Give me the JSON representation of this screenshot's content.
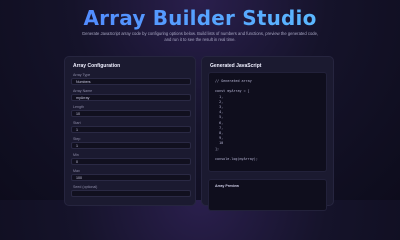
{
  "header": {
    "title": "Array Builder Studio",
    "subtitle": "Generate JavaScript array code by configuring options below. Build lists of numbers and functions, preview the generated code, and run it to see the result in real time."
  },
  "config_panel": {
    "title": "Array Configuration",
    "fields": [
      {
        "label": "Array Type",
        "value": "Numbers"
      },
      {
        "label": "Array Name",
        "value": "myArray"
      },
      {
        "label": "Length",
        "value": "10"
      },
      {
        "label": "Start",
        "value": "1"
      },
      {
        "label": "Step",
        "value": "1"
      },
      {
        "label": "Min",
        "value": "0"
      },
      {
        "label": "Max",
        "value": "100"
      },
      {
        "label": "Seed (optional)",
        "value": ""
      }
    ]
  },
  "output_panel": {
    "title": "Generated JavaScript",
    "code_lines": [
      "// Generated array",
      "",
      "const myArray = [",
      "  1,",
      "  2,",
      "  3,",
      "  4,",
      "  5,",
      "  6,",
      "  7,",
      "  8,",
      "  9,",
      "  10",
      "];",
      "",
      "console.log(myArray);"
    ],
    "result_label": "Array Preview"
  }
}
